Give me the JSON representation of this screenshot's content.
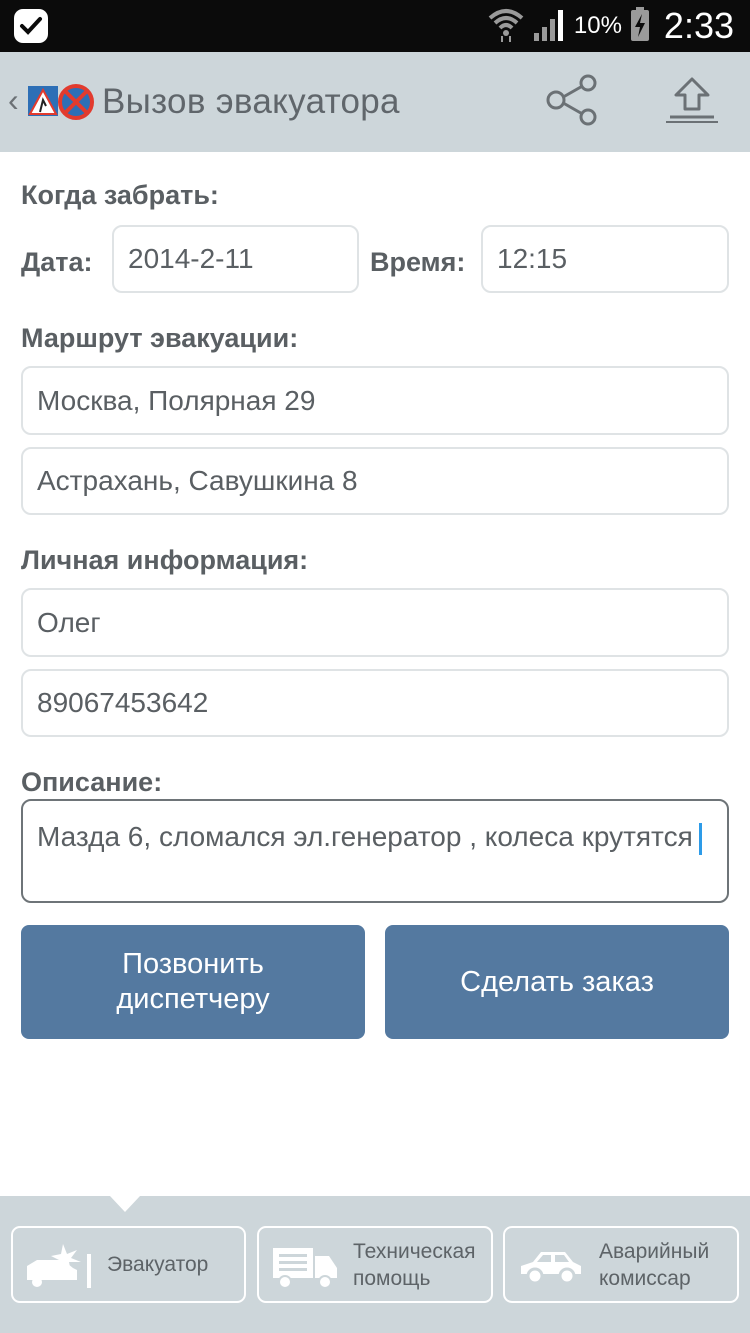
{
  "status_bar": {
    "battery_percent": "10%",
    "time": "2:33"
  },
  "header": {
    "title": "Вызов эвакуатора"
  },
  "form": {
    "pickup_section": "Когда забрать:",
    "date_label": "Дата:",
    "date_value": "2014-2-11",
    "time_label": "Время:",
    "time_value": "12:15",
    "route_section": "Маршрут эвакуации:",
    "route_from": "Москва, Полярная 29",
    "route_to": "Астрахань, Савушкина 8",
    "personal_section": "Личная информация:",
    "name_value": "Олег",
    "phone_value": "89067453642",
    "description_section": "Описание:",
    "description_value": "Мазда 6, сломался эл.генератор , колеса крутятся"
  },
  "buttons": {
    "call_dispatcher": "Позвонить диспетчеру",
    "place_order": "Сделать заказ"
  },
  "tabs": [
    {
      "label": "Эвакуатор",
      "icon": "crashed-car-icon"
    },
    {
      "label": "Техническая помощь",
      "icon": "truck-icon"
    },
    {
      "label": "Аварийный комиссар",
      "icon": "car-icon"
    }
  ],
  "colors": {
    "header_bg": "#cdd6da",
    "button_bg": "#5479a0",
    "cursor": "#2d9be8"
  }
}
